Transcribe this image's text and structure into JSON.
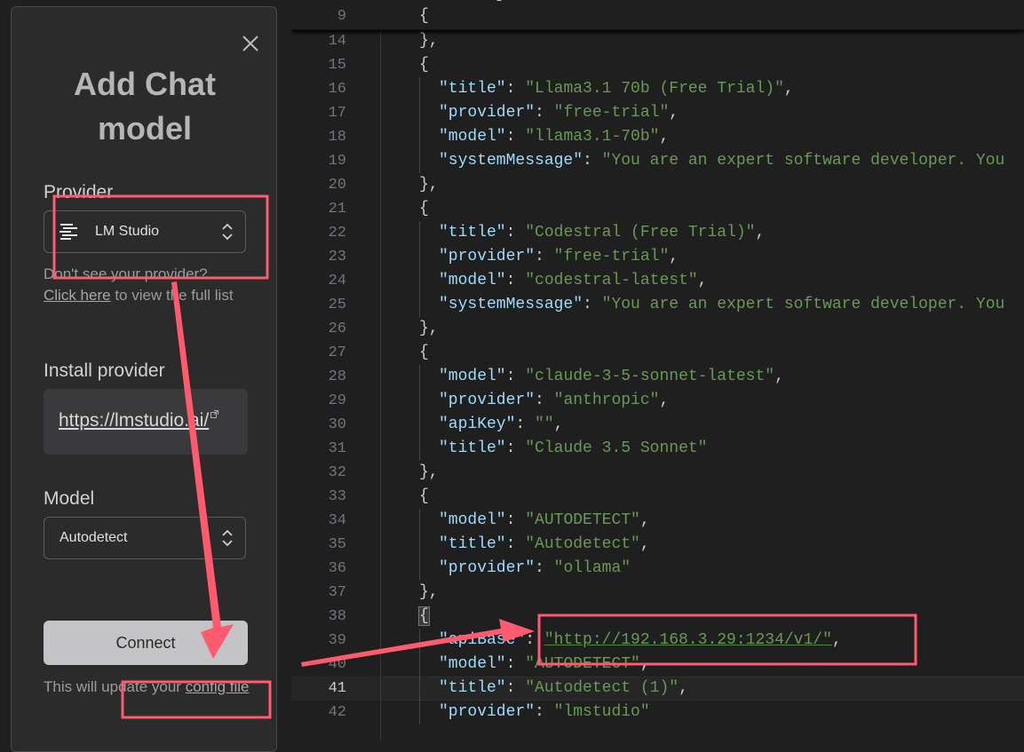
{
  "dialog": {
    "title_line1": "Add Chat",
    "title_line2": "model",
    "provider_label": "Provider",
    "provider_value": "LM Studio",
    "hint_prefix": "Don't see your provider?",
    "hint_link": "Click here",
    "hint_suffix": " to view the full list",
    "install_label": "Install provider",
    "install_url": "https://lmstudio.ai/",
    "model_label": "Model",
    "model_value": "Autodetect",
    "connect_label": "Connect",
    "footer_prefix": "This will update your ",
    "footer_link": "config file"
  },
  "editor": {
    "sticky": {
      "num": "9",
      "text": "{"
    },
    "lines": [
      {
        "num": "14",
        "level": 1,
        "text": "},"
      },
      {
        "num": "15",
        "level": 1,
        "text": "{"
      },
      {
        "num": "16",
        "level": 2,
        "key": "\"title\"",
        "value": "\"Llama3.1 70b (Free Trial)\"",
        "tail": ","
      },
      {
        "num": "17",
        "level": 2,
        "key": "\"provider\"",
        "value": "\"free-trial\"",
        "tail": ","
      },
      {
        "num": "18",
        "level": 2,
        "key": "\"model\"",
        "value": "\"llama3.1-70b\"",
        "tail": ","
      },
      {
        "num": "19",
        "level": 2,
        "key": "\"systemMessage\"",
        "value": "\"You are an expert software developer. You",
        "tail": ""
      },
      {
        "num": "20",
        "level": 1,
        "text": "},"
      },
      {
        "num": "21",
        "level": 1,
        "text": "{"
      },
      {
        "num": "22",
        "level": 2,
        "key": "\"title\"",
        "value": "\"Codestral (Free Trial)\"",
        "tail": ","
      },
      {
        "num": "23",
        "level": 2,
        "key": "\"provider\"",
        "value": "\"free-trial\"",
        "tail": ","
      },
      {
        "num": "24",
        "level": 2,
        "key": "\"model\"",
        "value": "\"codestral-latest\"",
        "tail": ","
      },
      {
        "num": "25",
        "level": 2,
        "key": "\"systemMessage\"",
        "value": "\"You are an expert software developer. You",
        "tail": ""
      },
      {
        "num": "26",
        "level": 1,
        "text": "},"
      },
      {
        "num": "27",
        "level": 1,
        "text": "{"
      },
      {
        "num": "28",
        "level": 2,
        "key": "\"model\"",
        "value": "\"claude-3-5-sonnet-latest\"",
        "tail": ","
      },
      {
        "num": "29",
        "level": 2,
        "key": "\"provider\"",
        "value": "\"anthropic\"",
        "tail": ","
      },
      {
        "num": "30",
        "level": 2,
        "key": "\"apiKey\"",
        "value": "\"\"",
        "tail": ","
      },
      {
        "num": "31",
        "level": 2,
        "key": "\"title\"",
        "value": "\"Claude 3.5 Sonnet\"",
        "tail": ""
      },
      {
        "num": "32",
        "level": 1,
        "text": "},"
      },
      {
        "num": "33",
        "level": 1,
        "text": "{"
      },
      {
        "num": "34",
        "level": 2,
        "key": "\"model\"",
        "value": "\"AUTODETECT\"",
        "tail": ","
      },
      {
        "num": "35",
        "level": 2,
        "key": "\"title\"",
        "value": "\"Autodetect\"",
        "tail": ","
      },
      {
        "num": "36",
        "level": 2,
        "key": "\"provider\"",
        "value": "\"ollama\"",
        "tail": ""
      },
      {
        "num": "37",
        "level": 1,
        "text": "},"
      },
      {
        "num": "38",
        "level": 1,
        "text": "{",
        "bracket_match": true
      },
      {
        "num": "39",
        "level": 2,
        "key": "\"apiBase\"",
        "value": "\"http://192.168.3.29:1234/v1/\"",
        "tail": ",",
        "url": true
      },
      {
        "num": "40",
        "level": 2,
        "key": "\"model\"",
        "value": "\"AUTODETECT\"",
        "tail": ","
      },
      {
        "num": "41",
        "level": 2,
        "key": "\"title\"",
        "value": "\"Autodetect (1)\"",
        "tail": ",",
        "current": true
      },
      {
        "num": "42",
        "level": 2,
        "key": "\"provider\"",
        "value": "\"lmstudio\"",
        "tail": ""
      }
    ]
  },
  "colors": {
    "annotation": "#ff5a6e",
    "json_key": "#9cdcfe",
    "json_string": "#6a9955"
  }
}
